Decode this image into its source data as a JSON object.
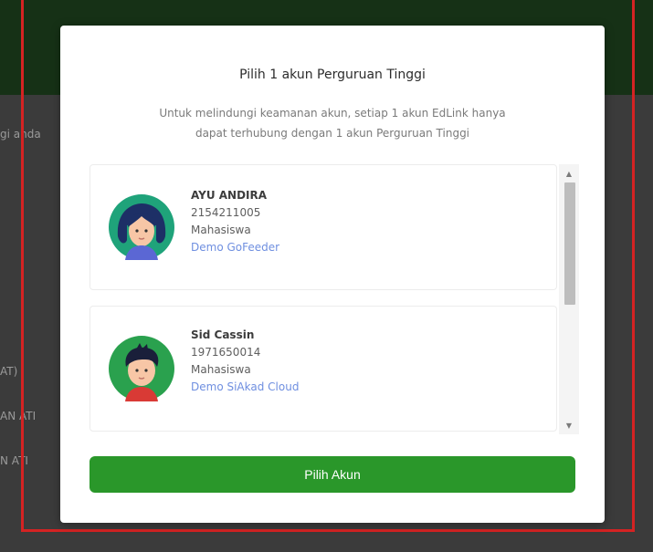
{
  "background": {
    "labels": [
      "gi anda",
      "AT)",
      "AN ATI",
      "N ATI"
    ]
  },
  "modal": {
    "title": "Pilih 1 akun Perguruan Tinggi",
    "description_line1": "Untuk melindungi keamanan akun, setiap 1 akun EdLink hanya",
    "description_line2": "dapat terhubung dengan 1 akun Perguruan Tinggi",
    "accounts": [
      {
        "name": "AYU ANDIRA",
        "id_number": "2154211005",
        "role": "Mahasiswa",
        "app": "Demo GoFeeder",
        "avatar_icon": "female-student-avatar-icon"
      },
      {
        "name": "Sid Cassin",
        "id_number": "1971650014",
        "role": "Mahasiswa",
        "app": "Demo SiAkad Cloud",
        "avatar_icon": "male-student-avatar-icon"
      }
    ],
    "choose_button_label": "Pilih Akun"
  },
  "colors": {
    "accent_green": "#2a972a",
    "link_blue": "#6f8fe0",
    "frame_red": "#d42323"
  }
}
